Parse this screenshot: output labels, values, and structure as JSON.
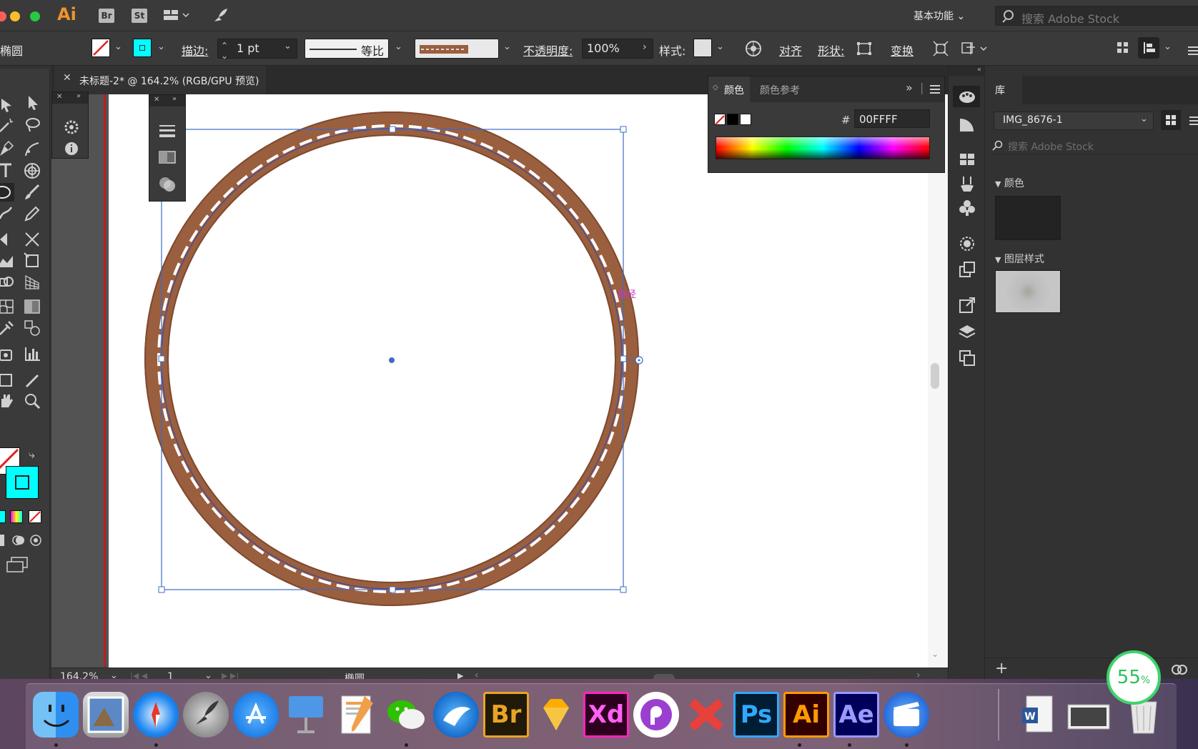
{
  "titlebar": {
    "app_logo": "Ai",
    "bridge_badge": "Br",
    "stock_badge": "St",
    "workspace": "基本功能",
    "stock_search_placeholder": "搜索 Adobe Stock"
  },
  "controlbar": {
    "object_type": "椭圆",
    "stroke_label": "描边:",
    "stroke_weight": "1 pt",
    "stroke_profile": "等比",
    "opacity_label": "不透明度:",
    "opacity_value": "100%",
    "style_label": "样式:",
    "align_label": "对齐",
    "shape_label": "形状:",
    "transform_label": "变换"
  },
  "document": {
    "tab_title": "未标题-2* @ 164.2% (RGB/GPU 预览)"
  },
  "canvas": {
    "smart_guide_label": "路径"
  },
  "color_panel": {
    "tab_color": "颜色",
    "tab_color_guide": "颜色参考",
    "hex_label": "#",
    "hex_value": "00FFFF"
  },
  "library": {
    "tab_label": "库",
    "library_name": "IMG_8676-1",
    "search_placeholder": "搜索 Adobe Stock",
    "section_colors": "颜色",
    "section_layer_styles": "图层样式"
  },
  "statusbar": {
    "zoom": "164.2%",
    "artboard_number": "1",
    "current_tool": "椭圆"
  },
  "dock": {
    "apps": [
      "Finder",
      "Preview",
      "Safari",
      "Launchpad",
      "App Store",
      "Keynote",
      "Pages",
      "WeChat",
      "Sparrow",
      "Bridge",
      "Sketch",
      "Xd",
      "PicPick",
      "XMind",
      "Photoshop",
      "Illustrator",
      "After Effects",
      "Screenium",
      "Word",
      "Screen",
      "Trash"
    ],
    "badge_br": "Br",
    "badge_xd": "Xd",
    "badge_ps": "Ps",
    "badge_ai": "Ai",
    "badge_ae": "Ae"
  },
  "progress_badge": {
    "value": "55",
    "unit": "%"
  },
  "colors": {
    "fill_swatch": "#00FFFF",
    "accent_selection": "#3d6cc9",
    "leather_ring": "#9a5f3e",
    "app_orange": "#f0922a"
  }
}
